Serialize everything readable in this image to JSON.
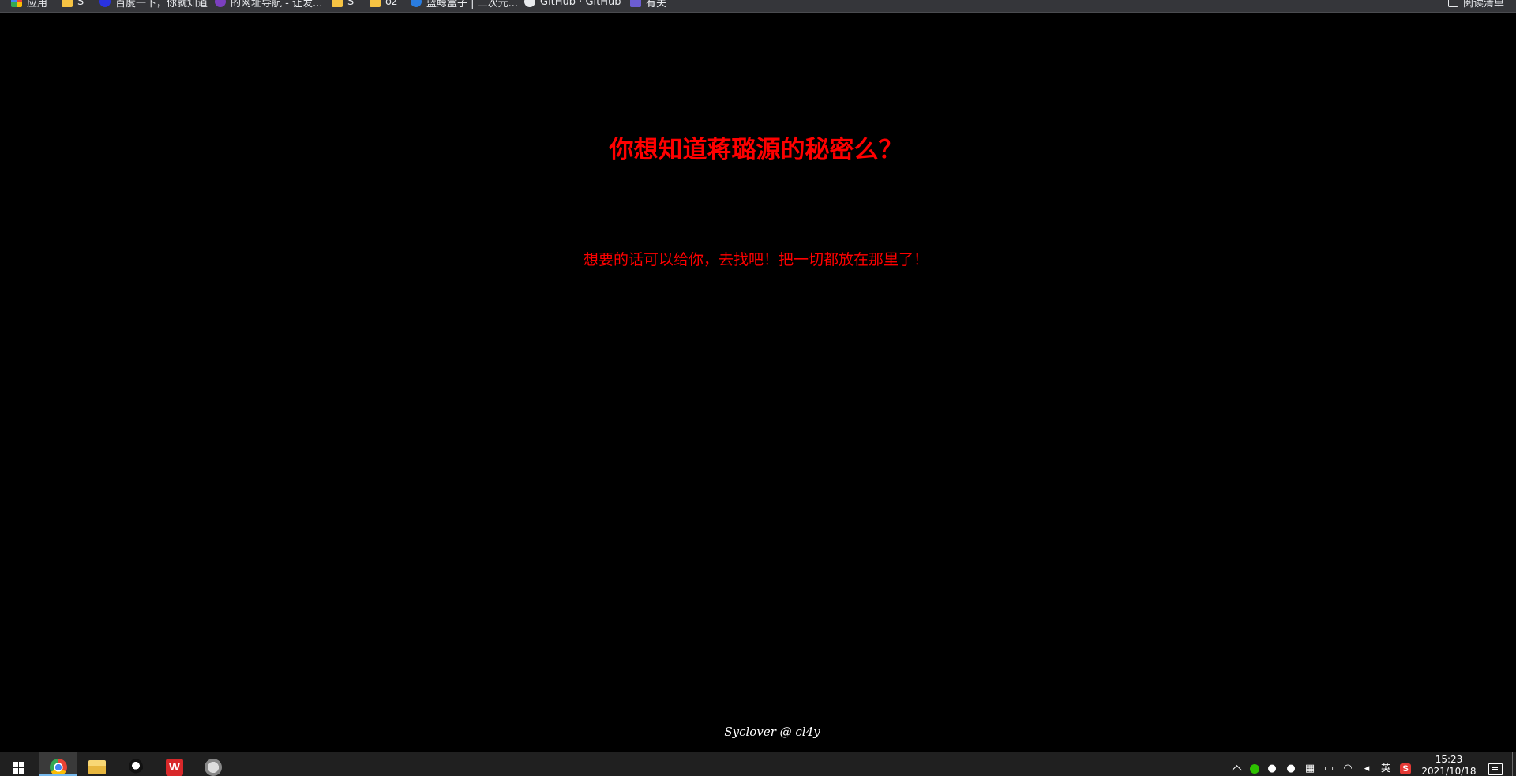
{
  "bookmarks": [
    {
      "label": "应用",
      "icon": "apps-icon"
    },
    {
      "label": "S",
      "icon": "folder-icon"
    },
    {
      "label": "百度一下，你就知道",
      "icon": "baidu-icon"
    },
    {
      "label": "的网址导航 - 让发...",
      "icon": "nav-site-icon"
    },
    {
      "label": "S",
      "icon": "folder-icon"
    },
    {
      "label": "oz",
      "icon": "folder-icon"
    },
    {
      "label": "蓝鲸盒子 | 二次元...",
      "icon": "blue-circle-icon"
    },
    {
      "label": "GitHub · GitHub",
      "icon": "github-icon"
    },
    {
      "label": "有关",
      "icon": "bookmark-icon"
    }
  ],
  "reading_list": "阅读清单",
  "page": {
    "title": "你想知道蒋璐源的秘密么？",
    "subtitle": "想要的话可以给你，去找吧！把一切都放在那里了！",
    "footer": "Syclover @ cl4y"
  },
  "taskbar": {
    "apps": [
      "chrome-icon",
      "file-explorer-icon",
      "qq-icon",
      "wps-icon",
      "avatar-app-icon"
    ],
    "wps_glyph": "W",
    "tray": {
      "lang": "英",
      "sogou_glyph": "S",
      "time": "15:23",
      "date": "2021/10/18"
    }
  }
}
